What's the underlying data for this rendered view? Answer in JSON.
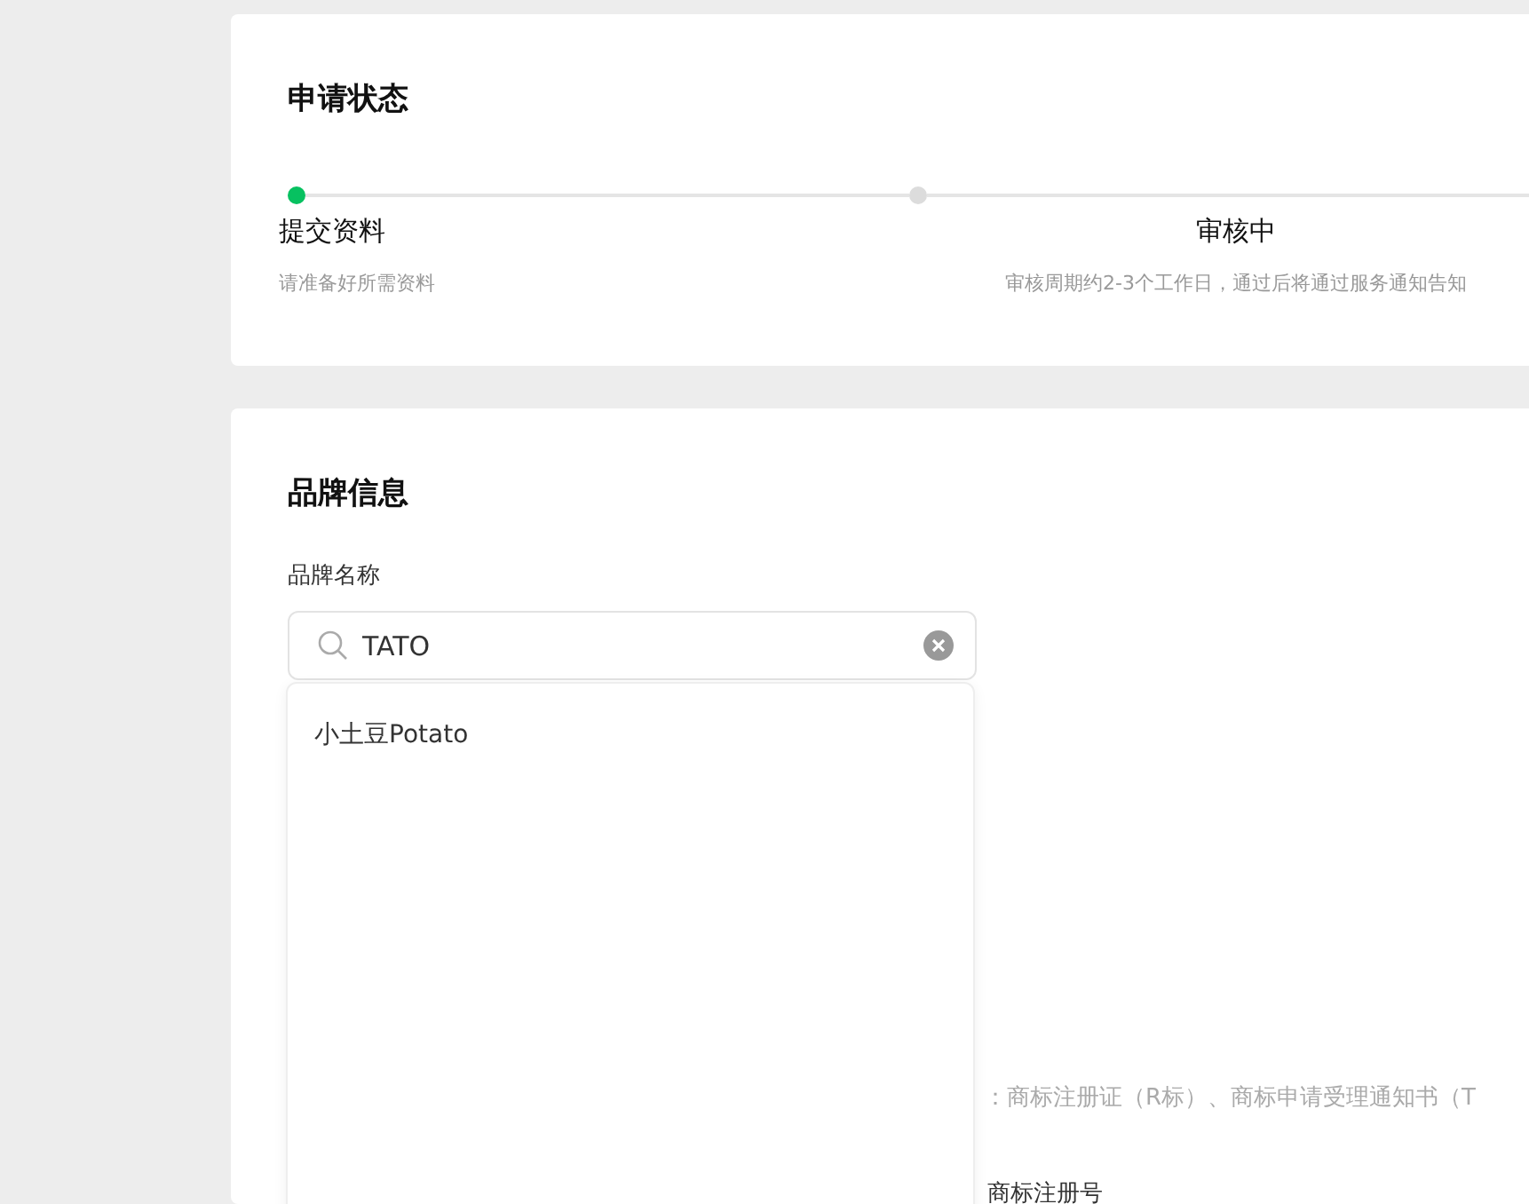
{
  "status_card": {
    "title": "申请状态",
    "steps": [
      {
        "label": "提交资料",
        "hint": "请准备好所需资料",
        "active": true
      },
      {
        "label": "审核中",
        "hint": "审核周期约2-3个工作日，通过后将通过服务通知告知",
        "active": false
      }
    ]
  },
  "brand_card": {
    "title": "品牌信息",
    "field_label": "品牌名称",
    "search": {
      "value": "TATO"
    },
    "suggestions": [
      "小土豆Potato"
    ],
    "type_note": "：商标注册证（R标）、商标申请受理通知书（T",
    "registration_label": "商标注册号"
  }
}
